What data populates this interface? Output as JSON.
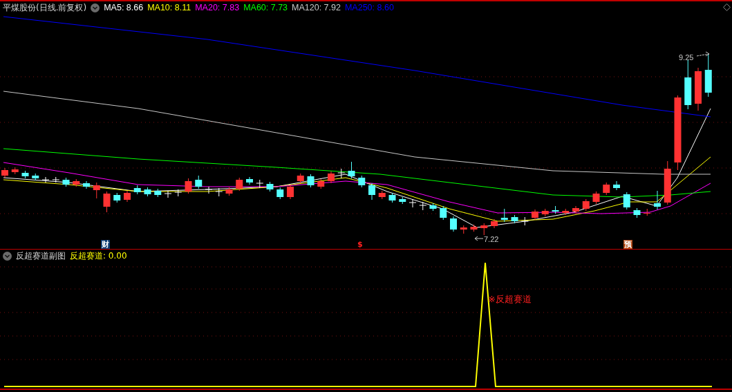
{
  "header": {
    "title": "平煤股份(日线.前复权)",
    "indicators": [
      {
        "label": "MA5: 8.66",
        "color": "#ffffff"
      },
      {
        "label": "MA10: 8.11",
        "color": "#ffff00"
      },
      {
        "label": "MA20: 7.83",
        "color": "#ff00ff"
      },
      {
        "label": "MA60: 7.73",
        "color": "#00ff00"
      },
      {
        "label": "MA120: 7.92",
        "color": "#c8c8c8"
      },
      {
        "label": "MA250: 8.60",
        "color": "#0000ff"
      }
    ]
  },
  "main_chart": {
    "high_label": "9.25",
    "low_label": "7.22",
    "markers": [
      {
        "text": "财",
        "kind": "finance"
      },
      {
        "text": "$",
        "kind": "dividend"
      },
      {
        "text": "预",
        "kind": "forecast"
      }
    ]
  },
  "sub_chart": {
    "title": "反超赛道副图",
    "indicator": {
      "label": "反超赛道: 0.00",
      "color": "#ffff00"
    },
    "signal_label": "※反超赛道"
  }
}
